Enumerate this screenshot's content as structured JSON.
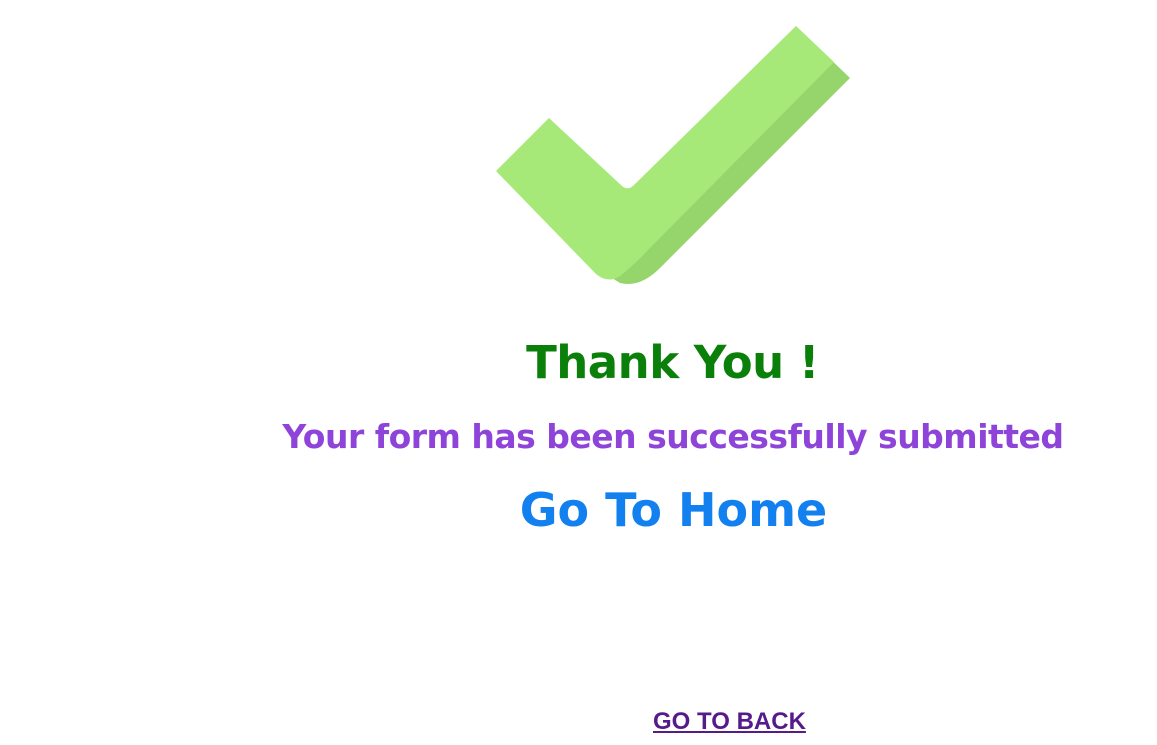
{
  "icon": "check-mark-icon",
  "colors": {
    "check_light": "#a6e978",
    "check_shade": "#96d56c",
    "title": "#0a800a",
    "subtitle": "#8e44d9",
    "home_link": "#1380f0",
    "back_link": "#551a8b"
  },
  "heading": {
    "title": "Thank You !",
    "subtitle": "Your form has been successfully submitted"
  },
  "links": {
    "home_label": "Go To Home",
    "back_label": "GO TO BACK"
  }
}
